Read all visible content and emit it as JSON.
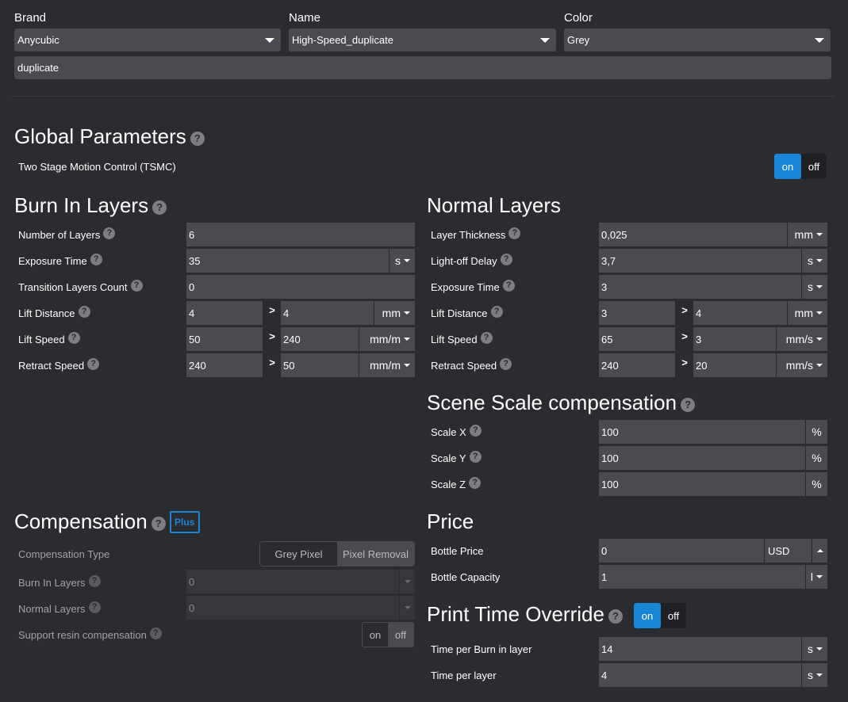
{
  "header": {
    "brand_label": "Brand",
    "brand_value": "Anycubic",
    "name_label": "Name",
    "name_value": "High-Speed_duplicate",
    "color_label": "Color",
    "color_value": "Grey",
    "notes_value": "duplicate"
  },
  "global": {
    "title": "Global Parameters",
    "tsmc_label": "Two Stage Motion Control (TSMC)",
    "tsmc_on": "on",
    "tsmc_off": "off"
  },
  "burn": {
    "title": "Burn In Layers",
    "num_layers_label": "Number of Layers",
    "num_layers": "6",
    "exposure_label": "Exposure Time",
    "exposure": "35",
    "exposure_unit": "s",
    "transition_label": "Transition Layers Count",
    "transition": "0",
    "lift_dist_label": "Lift Distance",
    "lift_dist_1": "4",
    "lift_dist_2": "4",
    "lift_dist_unit": "mm",
    "lift_speed_label": "Lift Speed",
    "lift_speed_1": "50",
    "lift_speed_2": "240",
    "lift_speed_unit": "mm/m",
    "retract_label": "Retract Speed",
    "retract_1": "240",
    "retract_2": "50",
    "retract_unit": "mm/m",
    "gt": ">"
  },
  "normal": {
    "title": "Normal Layers",
    "thickness_label": "Layer Thickness",
    "thickness": "0,025",
    "thickness_unit": "mm",
    "lightoff_label": "Light-off Delay",
    "lightoff": "3,7",
    "lightoff_unit": "s",
    "exposure_label": "Exposure Time",
    "exposure": "3",
    "exposure_unit": "s",
    "lift_dist_label": "Lift Distance",
    "lift_dist_1": "3",
    "lift_dist_2": "4",
    "lift_dist_unit": "mm",
    "lift_speed_label": "Lift Speed",
    "lift_speed_1": "65",
    "lift_speed_2": "3",
    "lift_speed_unit": "mm/s",
    "retract_label": "Retract Speed",
    "retract_1": "240",
    "retract_2": "20",
    "retract_unit": "mm/s"
  },
  "scale": {
    "title": "Scene Scale compensation",
    "x_label": "Scale X",
    "x": "100",
    "y_label": "Scale Y",
    "y": "100",
    "z_label": "Scale Z",
    "z": "100",
    "unit": "%"
  },
  "compensation": {
    "title": "Compensation",
    "plus": "Plus",
    "type_label": "Compensation Type",
    "type_opt1": "Grey Pixel",
    "type_opt2": "Pixel Removal",
    "burn_label": "Burn In Layers",
    "burn_value": "0",
    "normal_label": "Normal Layers",
    "normal_value": "0",
    "support_label": "Support resin compensation",
    "support_on": "on",
    "support_off": "off"
  },
  "price": {
    "title": "Price",
    "bottle_price_label": "Bottle Price",
    "bottle_price": "0",
    "currency": "USD",
    "bottle_capacity_label": "Bottle Capacity",
    "bottle_capacity": "1",
    "capacity_unit": "l"
  },
  "print_time": {
    "title": "Print Time Override",
    "on": "on",
    "off": "off",
    "burn_label": "Time per Burn in layer",
    "burn_value": "14",
    "burn_unit": "s",
    "layer_label": "Time per layer",
    "layer_value": "4",
    "layer_unit": "s"
  },
  "help_glyph": "?"
}
